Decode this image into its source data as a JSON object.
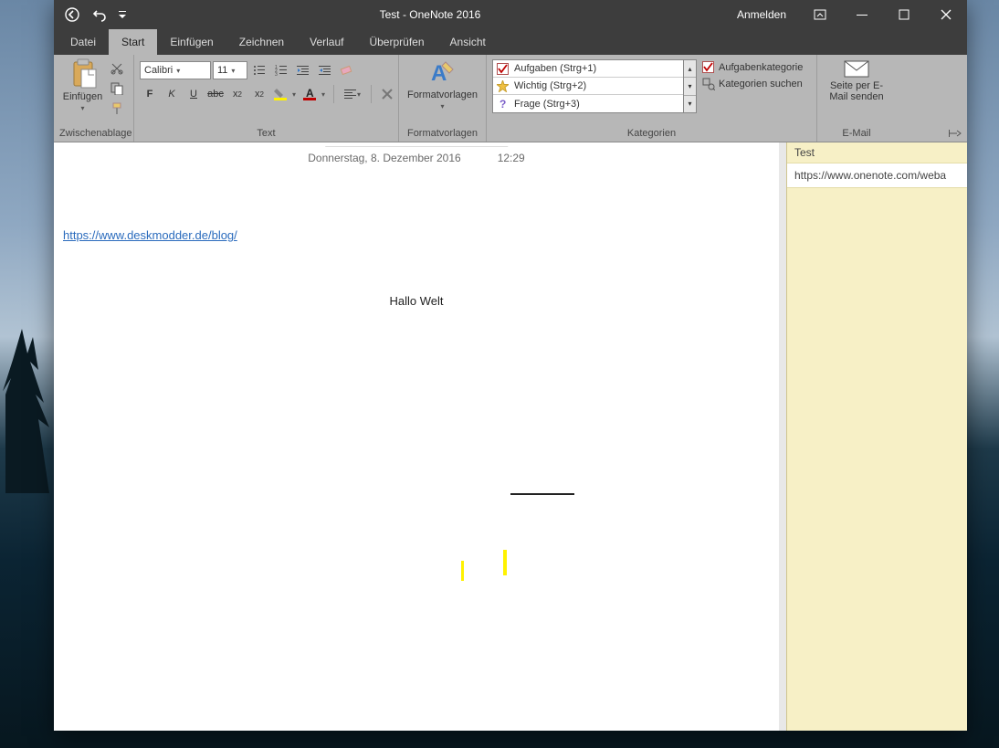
{
  "titlebar": {
    "doc_title": "Test",
    "separator": "  -  ",
    "app_name": "OneNote 2016",
    "signin": "Anmelden"
  },
  "menu": {
    "tabs": [
      "Datei",
      "Start",
      "Einfügen",
      "Zeichnen",
      "Verlauf",
      "Überprüfen",
      "Ansicht"
    ],
    "active_index": 1
  },
  "ribbon": {
    "clipboard": {
      "label": "Zwischenablage",
      "paste": "Einfügen"
    },
    "text": {
      "label": "Text",
      "font": "Calibri",
      "size": "11",
      "bold": "F",
      "italic": "K",
      "underline": "U",
      "strike": "abc",
      "sub": "x",
      "sup": "x"
    },
    "styles": {
      "big": "Formatvorlagen",
      "label": "Formatvorlagen"
    },
    "categories": {
      "label": "Kategorien",
      "items": [
        {
          "icon": "checkbox",
          "text": "Aufgaben (Strg+1)"
        },
        {
          "icon": "star",
          "text": "Wichtig (Strg+2)"
        },
        {
          "icon": "question",
          "text": "Frage (Strg+3)"
        }
      ],
      "task_category": "Aufgabenkategorie",
      "search": "Kategorien suchen"
    },
    "email": {
      "big_line1": "Seite per E-",
      "big_line2": "Mail senden",
      "label": "E-Mail"
    }
  },
  "page": {
    "date": "Donnerstag, 8. Dezember 2016",
    "time": "12:29",
    "link": "https://www.deskmodder.de/blog/",
    "hello": "Hallo Welt"
  },
  "sidepane": {
    "pages": [
      "Test",
      "https://www.onenote.com/weba"
    ]
  }
}
